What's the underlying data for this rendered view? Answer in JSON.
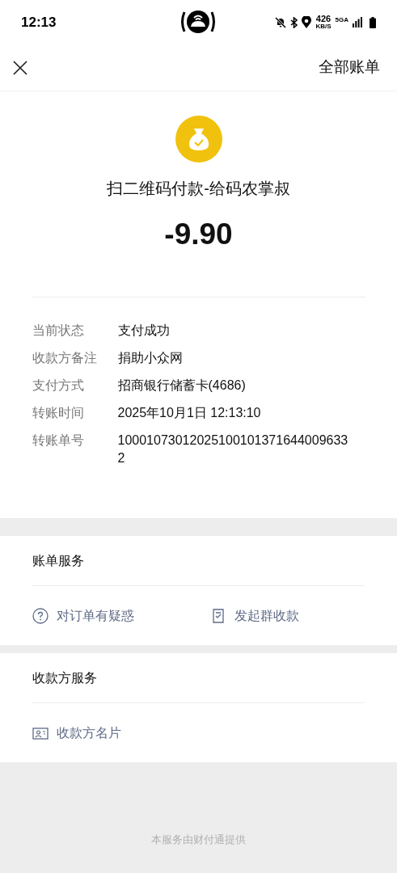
{
  "status_bar": {
    "time": "12:13",
    "speed": "426",
    "speed_unit": "KB/S",
    "network": "5GA"
  },
  "nav": {
    "action": "全部账单"
  },
  "payment": {
    "title": "扫二维码付款-给码农掌叔",
    "amount": "-9.90"
  },
  "details": [
    {
      "label": "当前状态",
      "value": "支付成功"
    },
    {
      "label": "收款方备注",
      "value": "捐助小众网"
    },
    {
      "label": "支付方式",
      "value": "招商银行储蓄卡(4686)"
    },
    {
      "label": "转账时间",
      "value": "2025年10月1日 12:13:10"
    },
    {
      "label": "转账单号",
      "value": "100010730120251001013716440096332"
    }
  ],
  "sections": [
    {
      "title": "账单服务",
      "links": [
        {
          "kind": "question",
          "label": "对订单有疑惑"
        },
        {
          "kind": "receipt",
          "label": "发起群收款"
        }
      ]
    },
    {
      "title": "收款方服务",
      "links": [
        {
          "kind": "card",
          "label": "收款方名片"
        }
      ]
    }
  ],
  "footer": "本服务由财付通提供"
}
